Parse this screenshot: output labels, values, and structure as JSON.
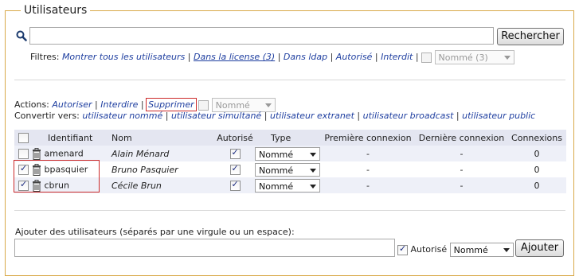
{
  "section_title": "Utilisateurs",
  "search": {
    "value": "",
    "button_label": "Rechercher"
  },
  "filters": {
    "label": "Filtres:",
    "links": [
      "Montrer tous les utilisateurs",
      "Dans la license (3)",
      "Dans ldap",
      "Autorisé",
      "Interdit"
    ],
    "type_select": "Nommé (3)"
  },
  "actions": {
    "label": "Actions:",
    "links": [
      "Autoriser",
      "Interdire",
      "Supprimer"
    ],
    "type_select": "Nommé"
  },
  "convert": {
    "label": "Convertir vers:",
    "links": [
      "utilisateur nommé",
      "utilisateur simultané",
      "utilisateur extranet",
      "utilisateur broadcast",
      "utilisateur public"
    ]
  },
  "table": {
    "headers": [
      "Identifiant",
      "Nom",
      "Autorisé",
      "Type",
      "Première connexion",
      "Dernière connexion",
      "Connexions"
    ],
    "rows": [
      {
        "selected": false,
        "id": "amenard",
        "name": "Alain Ménard",
        "authorized": true,
        "type": "Nommé",
        "first": "-",
        "last": "-",
        "count": "0"
      },
      {
        "selected": true,
        "id": "bpasquier",
        "name": "Bruno Pasquier",
        "authorized": true,
        "type": "Nommé",
        "first": "-",
        "last": "-",
        "count": "0"
      },
      {
        "selected": true,
        "id": "cbrun",
        "name": "Cécile Brun",
        "authorized": true,
        "type": "Nommé",
        "first": "-",
        "last": "-",
        "count": "0"
      }
    ]
  },
  "add": {
    "label": "Ajouter des utilisateurs (séparés par une virgule ou un espace):",
    "value": "",
    "authorized_label": "Autorisé",
    "authorized": true,
    "type_select": "Nommé",
    "button_label": "Ajouter"
  },
  "colors": {
    "border": "#d9a94a",
    "link": "#1f3fa0",
    "highlight": "#cc2a2a",
    "row_tint": "#eef0f8",
    "header_tint": "#e4e6f1"
  }
}
